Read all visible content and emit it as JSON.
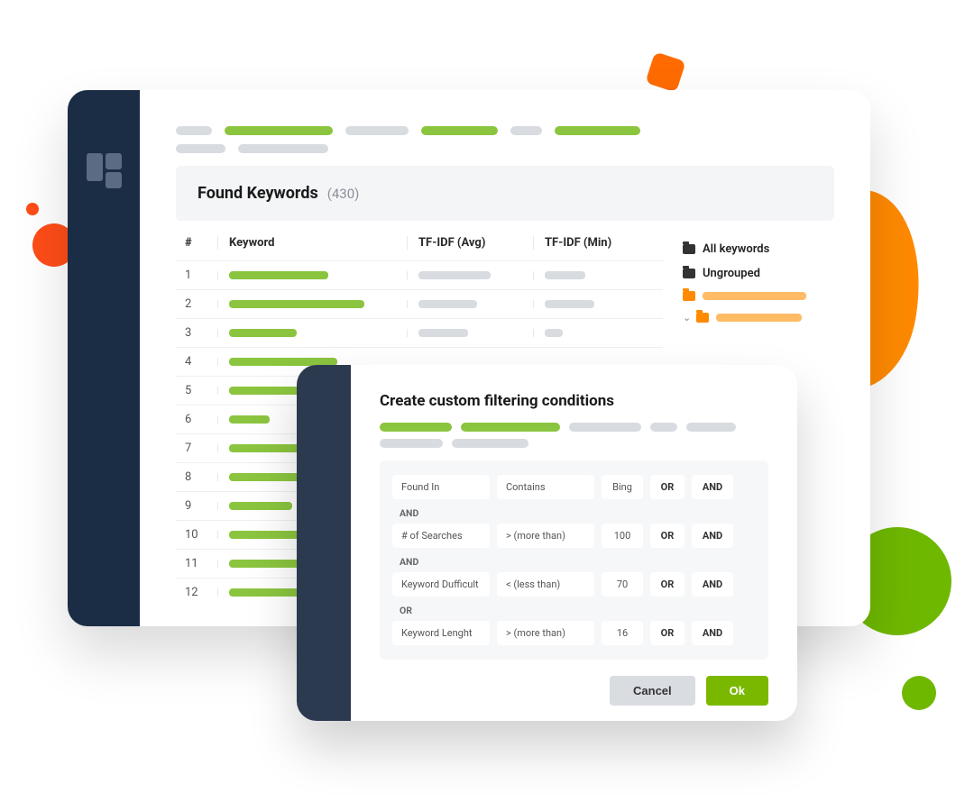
{
  "main": {
    "panel_title": "Found Keywords",
    "count": "(430)",
    "columns": {
      "idx": "#",
      "keyword": "Keyword",
      "avg": "TF-IDF (Avg)",
      "min": "TF-IDF (Min)"
    },
    "rows": [
      {
        "n": "1",
        "kw": 110,
        "avg": 80,
        "min": 45
      },
      {
        "n": "2",
        "kw": 150,
        "avg": 65,
        "min": 55
      },
      {
        "n": "3",
        "kw": 75,
        "avg": 55,
        "min": 20
      },
      {
        "n": "4",
        "kw": 120,
        "avg": 0,
        "min": 0
      },
      {
        "n": "5",
        "kw": 85,
        "avg": 0,
        "min": 0
      },
      {
        "n": "6",
        "kw": 45,
        "avg": 0,
        "min": 0
      },
      {
        "n": "7",
        "kw": 95,
        "avg": 0,
        "min": 0
      },
      {
        "n": "8",
        "kw": 130,
        "avg": 0,
        "min": 0
      },
      {
        "n": "9",
        "kw": 70,
        "avg": 0,
        "min": 0
      },
      {
        "n": "10",
        "kw": 105,
        "avg": 0,
        "min": 0
      },
      {
        "n": "11",
        "kw": 90,
        "avg": 0,
        "min": 0
      },
      {
        "n": "12",
        "kw": 115,
        "avg": 0,
        "min": 0
      }
    ],
    "groups": {
      "all": "All keywords",
      "ungrouped": "Ungrouped"
    }
  },
  "dialog": {
    "title": "Create custom filtering conditions",
    "rows": [
      {
        "field": "Found In",
        "op": "Contains",
        "val": "Bing",
        "or": "OR",
        "and": "AND",
        "conj_after": "AND"
      },
      {
        "field": "# of Searches",
        "op": "> (more than)",
        "val": "100",
        "or": "OR",
        "and": "AND",
        "conj_after": "AND"
      },
      {
        "field": "Keyword Dufficult",
        "op": "< (less than)",
        "val": "70",
        "or": "OR",
        "and": "AND",
        "conj_after": "OR"
      },
      {
        "field": "Keyword Lenght",
        "op": "> (more than)",
        "val": "16",
        "or": "OR",
        "and": "AND",
        "conj_after": ""
      }
    ],
    "cancel": "Cancel",
    "ok": "Ok"
  }
}
